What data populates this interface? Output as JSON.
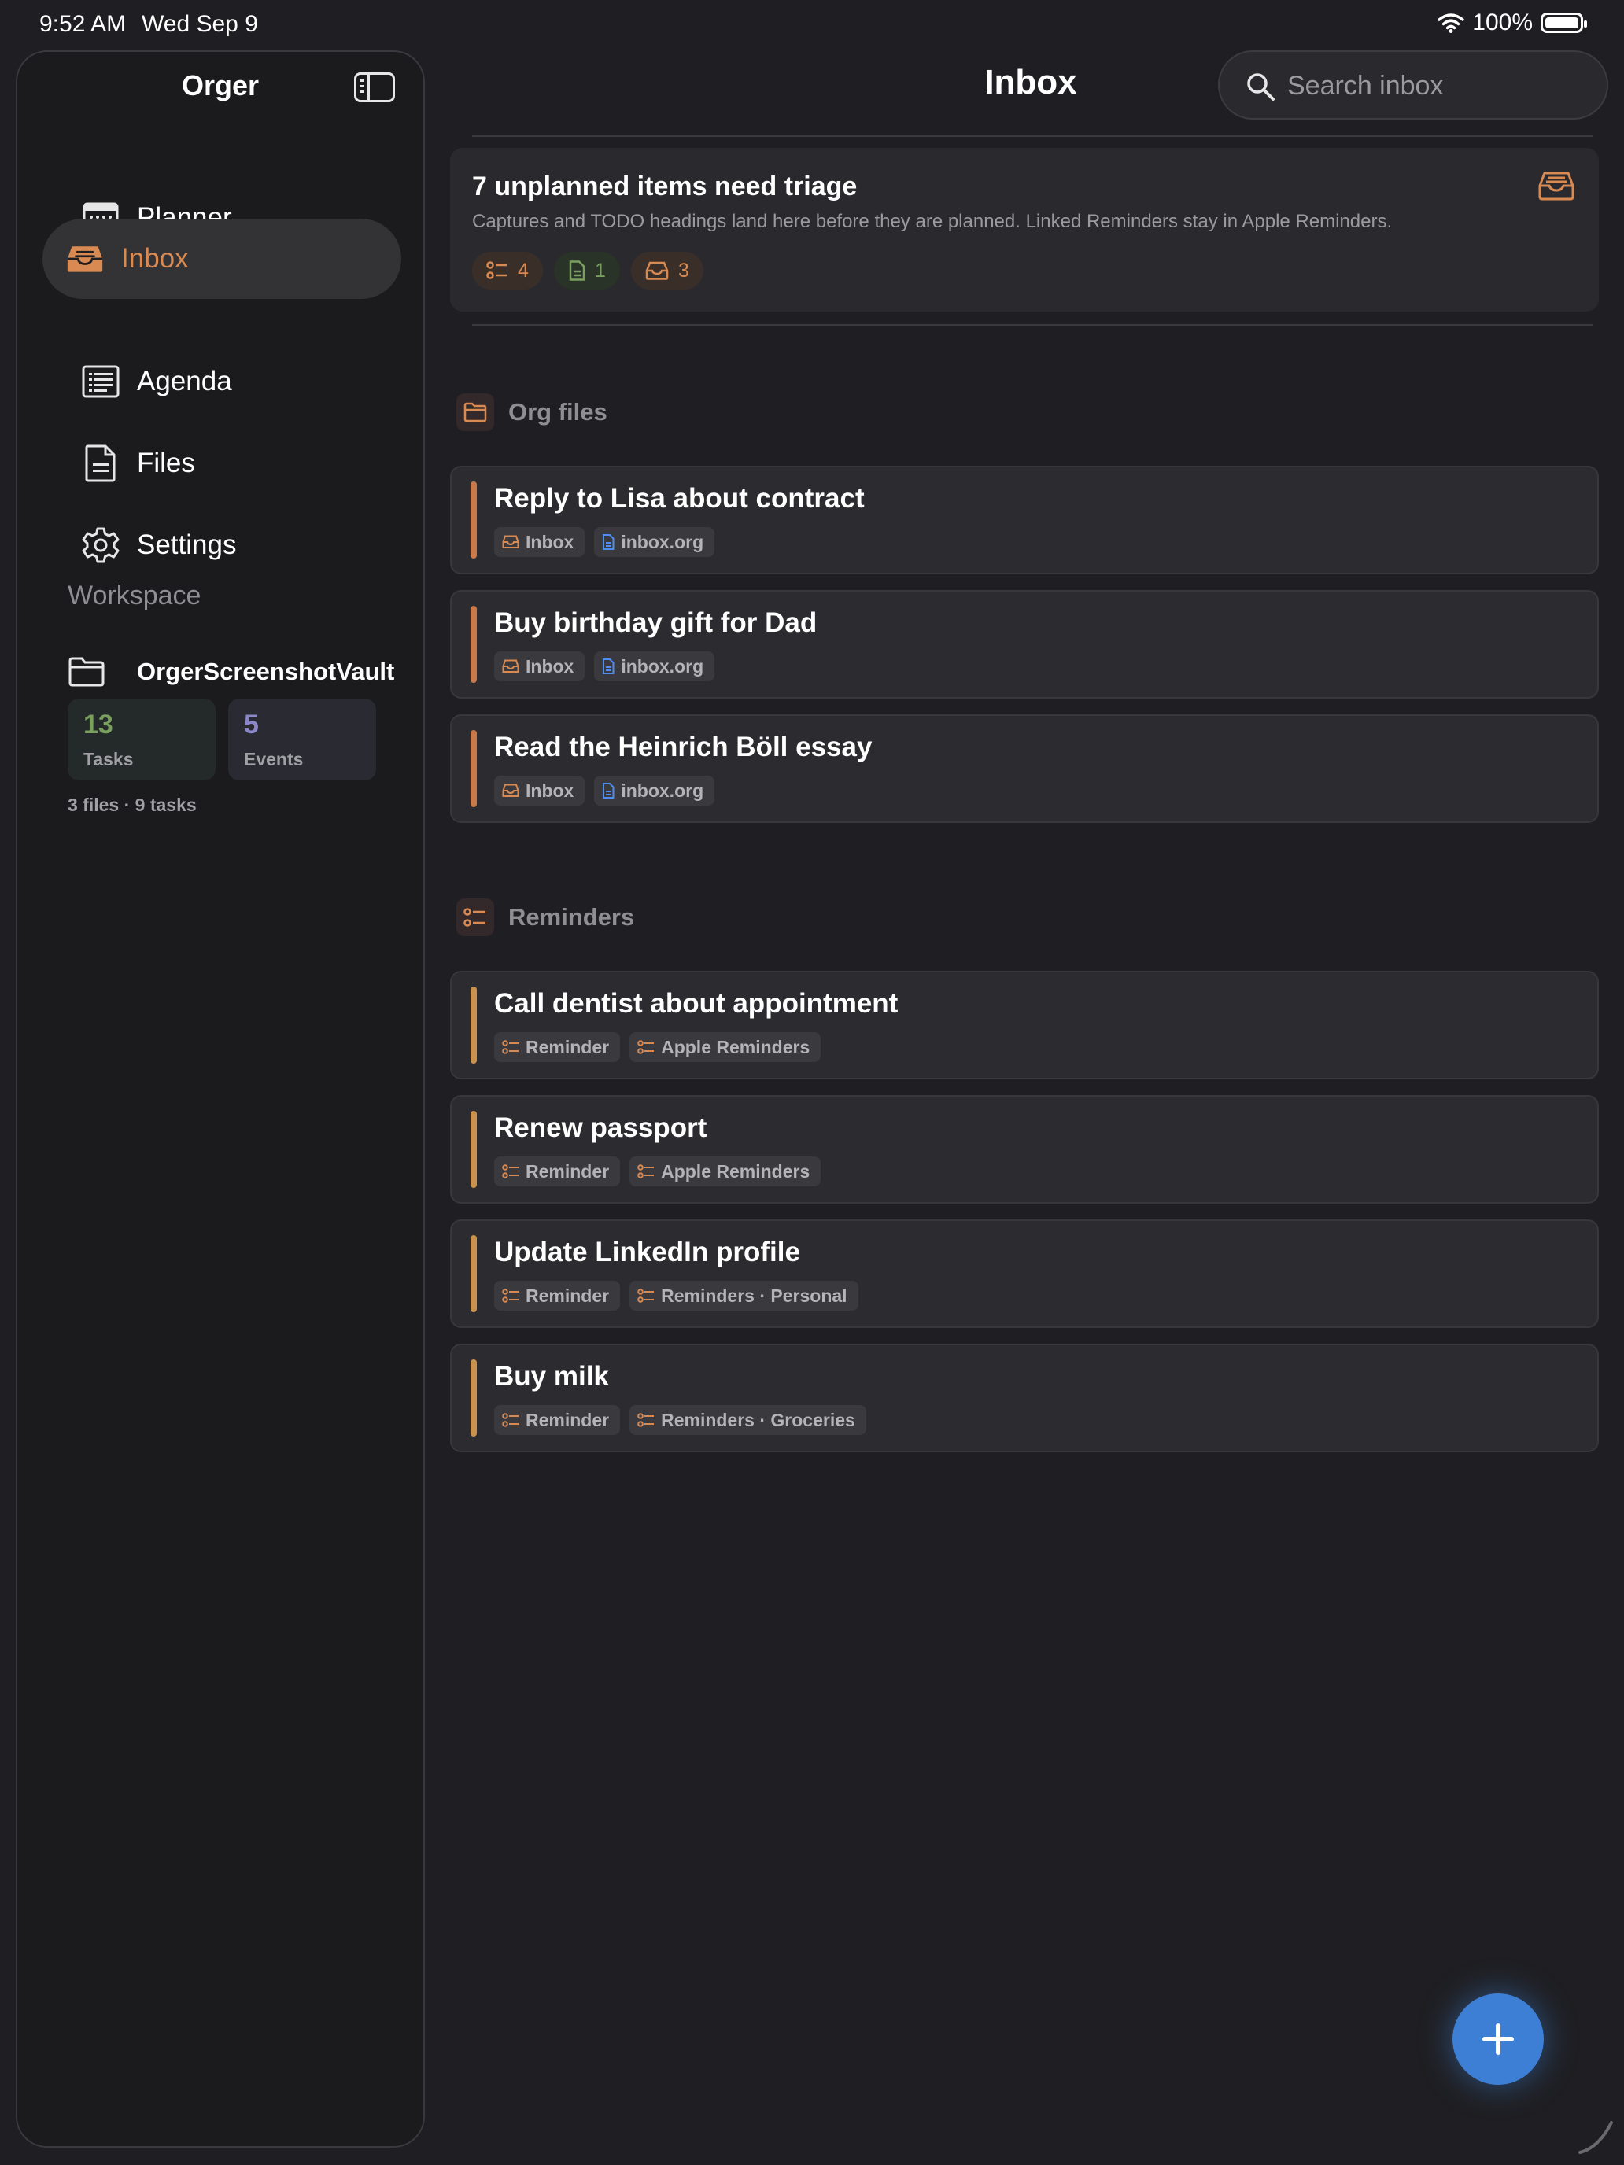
{
  "status_bar": {
    "time": "9:52 AM",
    "date": "Wed Sep 9",
    "battery": "100%"
  },
  "sidebar": {
    "title": "Orger",
    "items": [
      {
        "label": "Planner",
        "icon": "calendar-icon",
        "active": false
      },
      {
        "label": "Inbox",
        "icon": "inbox-tray-icon",
        "active": true
      },
      {
        "label": "Agenda",
        "icon": "list-icon",
        "active": false
      },
      {
        "label": "Files",
        "icon": "document-icon",
        "active": false
      },
      {
        "label": "Settings",
        "icon": "gear-icon",
        "active": false
      }
    ],
    "workspace": {
      "heading": "Workspace",
      "vault_name": "OrgerScreenshotVault",
      "tasks_count": "13",
      "tasks_label": "Tasks",
      "events_count": "5",
      "events_label": "Events",
      "summary": "3 files · 9 tasks"
    }
  },
  "header": {
    "title": "Inbox",
    "search_placeholder": "Search inbox"
  },
  "triage": {
    "title": "7 unplanned items need triage",
    "subtitle": "Captures and TODO headings land here before they are planned. Linked Reminders stay in Apple Reminders.",
    "reminders_count": "4",
    "files_count": "1",
    "inbox_count": "3"
  },
  "sections": [
    {
      "label": "Org files",
      "icon": "folder-icon",
      "items": [
        {
          "title": "Reply to Lisa about contract",
          "tags": [
            "Inbox",
            "inbox.org"
          ]
        },
        {
          "title": "Buy birthday gift for Dad",
          "tags": [
            "Inbox",
            "inbox.org"
          ]
        },
        {
          "title": "Read the Heinrich Böll essay",
          "tags": [
            "Inbox",
            "inbox.org"
          ]
        }
      ]
    },
    {
      "label": "Reminders",
      "icon": "checklist-icon",
      "items": [
        {
          "title": "Call dentist about appointment",
          "tags": [
            "Reminder",
            "Apple Reminders"
          ]
        },
        {
          "title": "Renew passport",
          "tags": [
            "Reminder",
            "Apple Reminders"
          ]
        },
        {
          "title": "Update LinkedIn profile",
          "tags": [
            "Reminder",
            "Reminders · Personal"
          ]
        },
        {
          "title": "Buy milk",
          "tags": [
            "Reminder",
            "Reminders · Groceries"
          ]
        }
      ]
    }
  ],
  "colors": {
    "accent": "#d98a52",
    "org_bar": "#c97a4a",
    "reminder_bar": "#c9924e",
    "fab": "#3d7fd4",
    "green": "#7aa05e",
    "purple": "#8a86c8"
  }
}
